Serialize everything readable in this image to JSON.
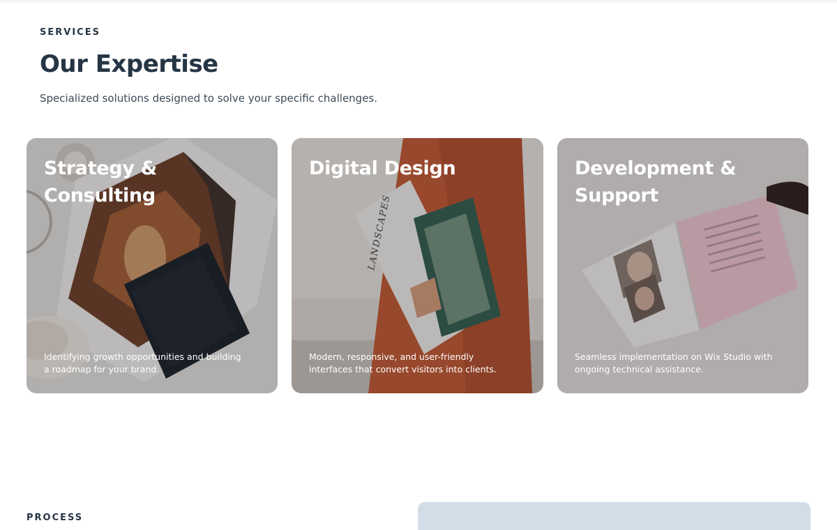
{
  "services": {
    "eyebrow": "SERVICES",
    "title": "Our Expertise",
    "subtitle": "Specialized solutions designed to solve your specific challenges.",
    "cards": [
      {
        "title": "Strategy & Consulting",
        "description": "Identifying growth opportunities and building a roadmap for your brand."
      },
      {
        "title": "Digital Design",
        "description": "Modern, responsive, and user-friendly interfaces that convert visitors into clients.",
        "image_text": "LANDSCAPES"
      },
      {
        "title": "Development & Support",
        "description": "Seamless implementation on Wix Studio with ongoing technical assistance."
      }
    ]
  },
  "process": {
    "eyebrow": "PROCESS"
  },
  "colors": {
    "heading": "#263544",
    "panel": "#d2dde8"
  }
}
